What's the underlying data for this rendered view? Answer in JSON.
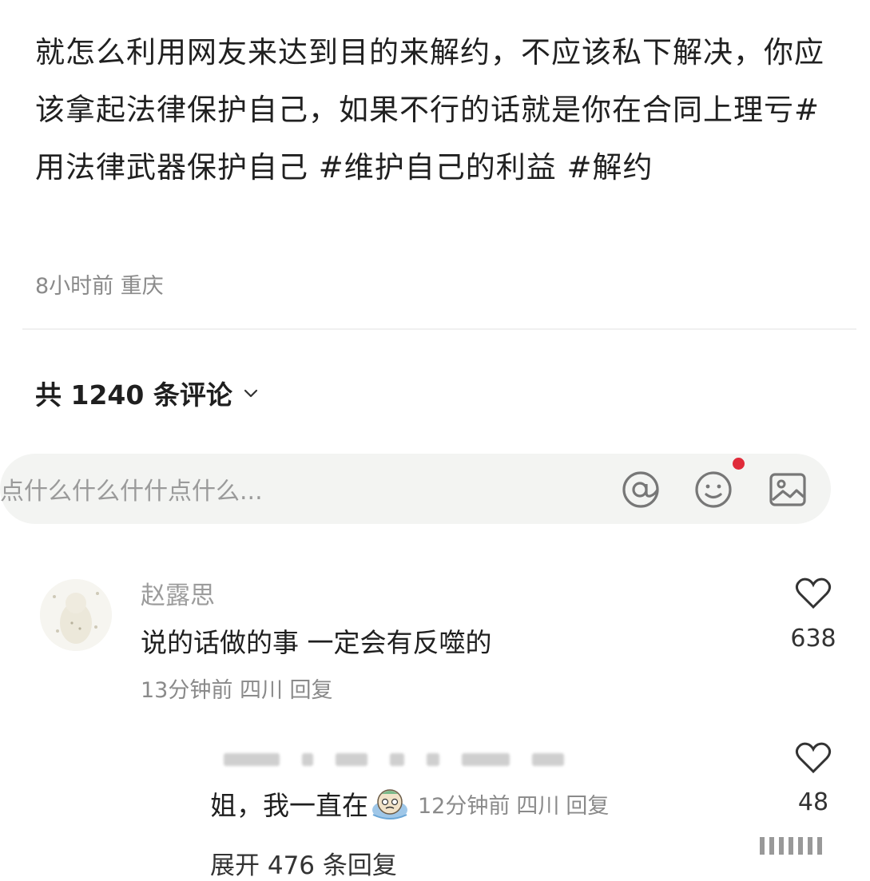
{
  "post": {
    "body": "就怎么利用网友来达到目的来解约，不应该私下解决，你应该拿起法律保护自己，如果不行的话就是你在合同上理亏",
    "tags": [
      "#用法律武器保护自己",
      "#维护自己的利益",
      "#解约"
    ],
    "time": "8小时前",
    "location": "重庆"
  },
  "comments_header": {
    "label": "共 1240 条评论",
    "chevron_icon": "chevron-down-icon"
  },
  "input": {
    "placeholder": "点什么什么什什点什么...",
    "icons": [
      "at-icon",
      "emoji-icon",
      "image-icon"
    ],
    "notification_dot_color": "#e02b3a"
  },
  "comment": {
    "author": "赵露思",
    "text": "说的话做的事 一定会有反噬的",
    "time": "13分钟前",
    "location": "四川",
    "reply_label": "回复",
    "likes": "638"
  },
  "reply": {
    "text": "姐，我一直在",
    "emoji": "crying-emoji",
    "time": "12分钟前",
    "location": "四川",
    "reply_label": "回复",
    "likes": "48"
  },
  "expand": {
    "label": "展开 476 条回复"
  }
}
